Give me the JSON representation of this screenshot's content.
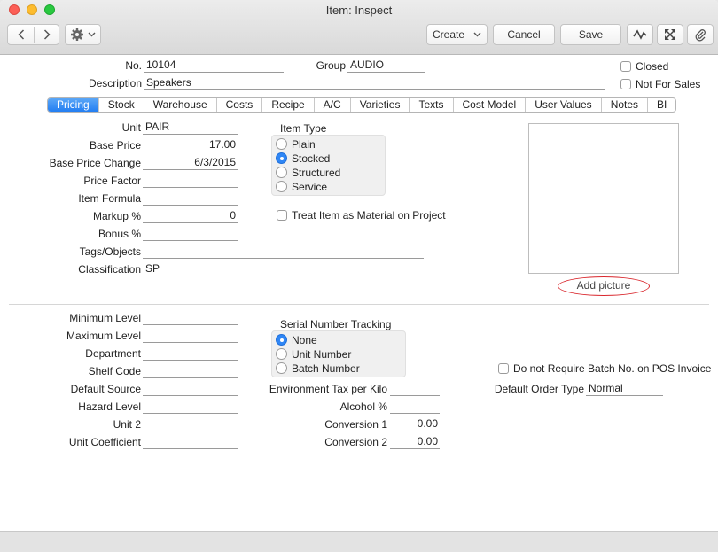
{
  "window": {
    "title": "Item: Inspect"
  },
  "toolbar": {
    "create_label": "Create",
    "cancel_label": "Cancel",
    "save_label": "Save"
  },
  "header": {
    "no_label": "No.",
    "no_value": "10104",
    "group_label": "Group",
    "group_value": "AUDIO",
    "description_label": "Description",
    "description_value": "Speakers",
    "closed_label": "Closed",
    "not_for_sales_label": "Not For Sales"
  },
  "tabs": [
    "Pricing",
    "Stock",
    "Warehouse",
    "Costs",
    "Recipe",
    "A/C",
    "Varieties",
    "Texts",
    "Cost Model",
    "User Values",
    "Notes",
    "BI"
  ],
  "pricing": {
    "unit_label": "Unit",
    "unit_value": "PAIR",
    "base_price_label": "Base Price",
    "base_price_value": "17.00",
    "base_price_change_label": "Base Price Change",
    "base_price_change_value": "6/3/2015",
    "price_factor_label": "Price Factor",
    "price_factor_value": "",
    "item_formula_label": "Item Formula",
    "item_formula_value": "",
    "markup_label": "Markup %",
    "markup_value": "0",
    "bonus_label": "Bonus %",
    "bonus_value": "",
    "tags_label": "Tags/Objects",
    "tags_value": "",
    "classification_label": "Classification",
    "classification_value": "SP",
    "item_type_title": "Item Type",
    "item_types": [
      "Plain",
      "Stocked",
      "Structured",
      "Service"
    ],
    "treat_material_label": "Treat Item as Material on Project",
    "add_picture_label": "Add picture"
  },
  "lower": {
    "min_level_label": "Minimum Level",
    "max_level_label": "Maximum Level",
    "department_label": "Department",
    "shelf_code_label": "Shelf Code",
    "default_source_label": "Default Source",
    "hazard_level_label": "Hazard Level",
    "unit2_label": "Unit 2",
    "unit_coefficient_label": "Unit Coefficient",
    "serial_title": "Serial Number Tracking",
    "serial_options": [
      "None",
      "Unit Number",
      "Batch Number"
    ],
    "env_tax_label": "Environment Tax per Kilo",
    "alcohol_label": "Alcohol %",
    "conversion1_label": "Conversion 1",
    "conversion1_value": "0.00",
    "conversion2_label": "Conversion 2",
    "conversion2_value": "0.00",
    "no_batch_label": "Do not Require Batch No. on POS Invoice",
    "default_order_type_label": "Default Order Type",
    "default_order_type_value": "Normal"
  }
}
